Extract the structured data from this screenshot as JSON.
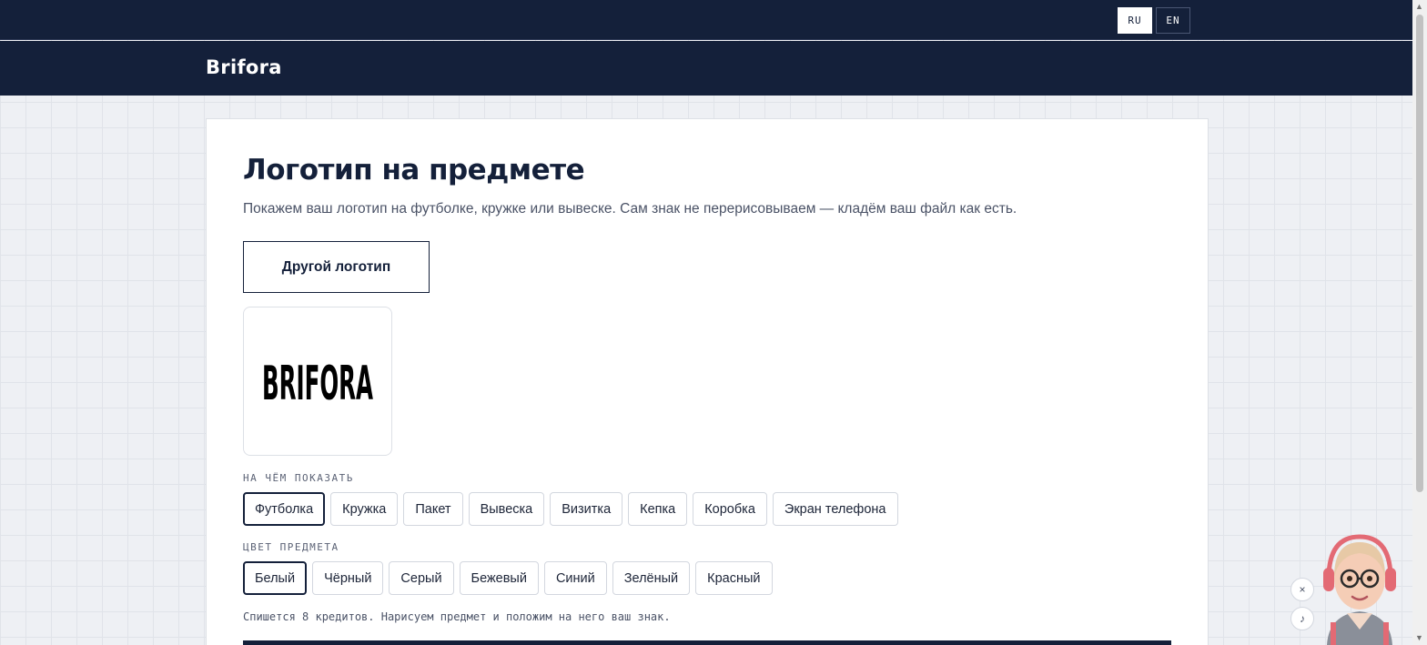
{
  "topbar": {
    "languages": [
      {
        "label": "RU",
        "active": true
      },
      {
        "label": "EN",
        "active": false
      }
    ]
  },
  "header": {
    "brand": "Brifora"
  },
  "main": {
    "title": "Логотип на предмете",
    "subtitle": "Покажем ваш логотип на футболке, кружке или вывеске. Сам знак не перерисовываем — кладём ваш файл как есть.",
    "other_logo_button": "Другой логотип",
    "logo_preview_text": "BRIFORA",
    "object_section": {
      "label": "НА ЧЁМ ПОКАЗАТЬ",
      "options": [
        "Футболка",
        "Кружка",
        "Пакет",
        "Вывеска",
        "Визитка",
        "Кепка",
        "Коробка",
        "Экран телефона"
      ],
      "selected": "Футболка"
    },
    "color_section": {
      "label": "ЦВЕТ ПРЕДМЕТА",
      "options": [
        "Белый",
        "Чёрный",
        "Серый",
        "Бежевый",
        "Синий",
        "Зелёный",
        "Красный"
      ],
      "selected": "Белый"
    },
    "credits_note": "Спишется 8 кредитов. Нарисуем предмет и положим на него ваш знак."
  },
  "widget": {
    "close_icon": "×",
    "music_icon": "♪"
  },
  "colors": {
    "navy": "#14203a",
    "page_bg": "#eef0f4",
    "card_bg": "#ffffff"
  }
}
